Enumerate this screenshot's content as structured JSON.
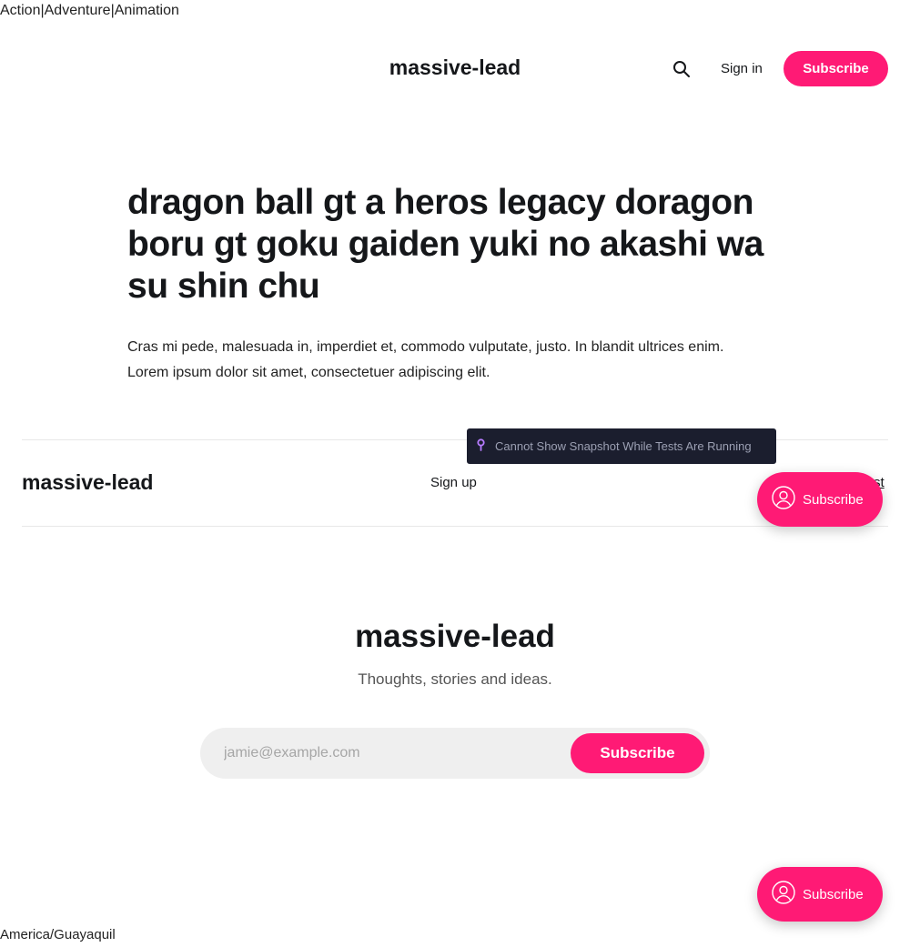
{
  "genres": [
    "Action",
    "Adventure",
    "Animation"
  ],
  "genre_separator": "|",
  "header": {
    "site_title": "massive-lead",
    "search_icon": "search-icon",
    "signin_label": "Sign in",
    "subscribe_label": "Subscribe"
  },
  "article": {
    "title": "dragon ball gt a heros legacy doragon boru gt goku gaiden yuki no akashi wa su shin chu",
    "excerpt": "Cras mi pede, malesuada in, imperdiet et, commodo vulputate, justo. In blandit ultrices enim. Lorem ipsum dolor sit amet, consectetuer adipiscing elit."
  },
  "tooltip": {
    "icon": "pin-icon",
    "text": "Cannot Show Snapshot While Tests Are Running"
  },
  "footer": {
    "site_title": "massive-lead",
    "signup_label": "Sign up",
    "partial_link": "st"
  },
  "cta": {
    "title": "massive-lead",
    "subtitle": "Thoughts, stories and ideas.",
    "email_placeholder": "jamie@example.com",
    "button_label": "Subscribe"
  },
  "floating": {
    "label": "Subscribe",
    "icon": "user-circle-icon"
  },
  "timezone": "America/Guayaquil",
  "colors": {
    "accent": "#ff1a75",
    "text": "#15171a",
    "tooltip_bg": "#1b1e2e"
  }
}
